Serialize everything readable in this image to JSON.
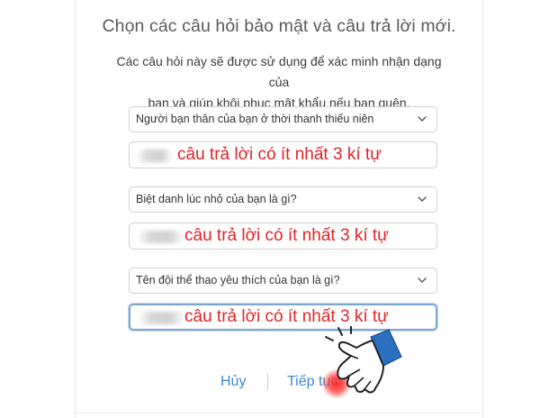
{
  "header": {
    "title": "Chọn các câu hỏi bảo mật và câu trả lời mới.",
    "subtitle_line1": "Các câu hỏi này sẽ được sử dụng để xác minh nhận dạng của",
    "subtitle_line2": "bạn và giúp khôi phục mật khẩu nếu bạn quên."
  },
  "questions": [
    {
      "question": "Người bạn thân của bạn ở thời thanh thiếu niên",
      "answer_hint": "câu trả lời có ít nhất 3 kí tự"
    },
    {
      "question": "Biệt danh lúc nhỏ của bạn là gì?",
      "answer_hint": "câu trả lời có ít nhất 3 kí tự"
    },
    {
      "question": "Tên đội thể thao yêu thích của bạn là gì?",
      "answer_hint": "câu trả lời có ít nhất 3 kí tự"
    }
  ],
  "actions": {
    "cancel_label": "Hủy",
    "continue_label": "Tiếp tục"
  },
  "colors": {
    "link": "#3f86cf",
    "hint": "#e0232a",
    "focus_border": "#7aa6d6"
  }
}
